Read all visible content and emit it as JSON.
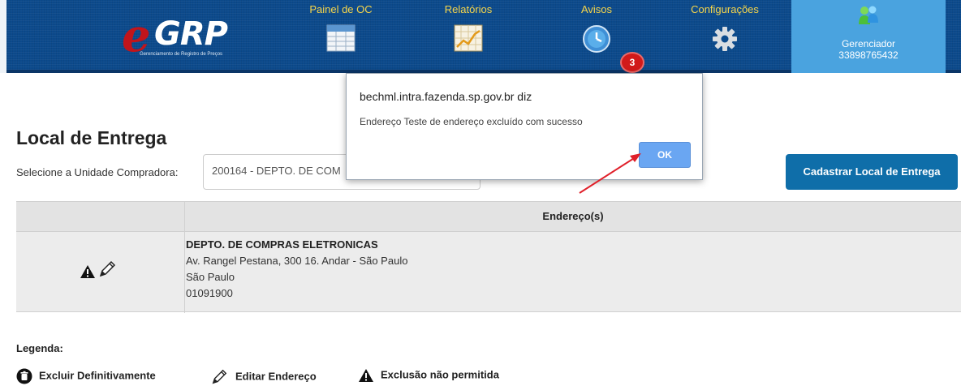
{
  "header": {
    "logo_text": "GRP",
    "logo_subtitle": "Gerenciamento de Registro de Preços",
    "nav": [
      {
        "label": "Painel de OC",
        "icon": "table-icon"
      },
      {
        "label": "Relatórios",
        "icon": "chart-icon"
      },
      {
        "label": "Avisos",
        "icon": "clock-icon"
      },
      {
        "label": "Configurações",
        "icon": "gear-icon"
      }
    ],
    "alerts_count": "3",
    "user": {
      "role": "Gerenciador",
      "id": "33898765432",
      "icon": "users-icon"
    }
  },
  "page": {
    "title": "Local de Entrega",
    "unit_label": "Selecione a Unidade Compradora:",
    "unit_value": "200164 - DEPTO. DE COM",
    "register_button": "Cadastrar Local de Entrega"
  },
  "table": {
    "header_address": "Endereço(s)",
    "rows": [
      {
        "name": "DEPTO. DE COMPRAS ELETRONICAS",
        "street": "Av. Rangel Pestana, 300 16. Andar - São Paulo",
        "city": "São Paulo",
        "zip": "01091900"
      }
    ]
  },
  "legend": {
    "title": "Legenda:",
    "items": [
      {
        "label": "Excluir Definitivamente",
        "icon": "trash-icon"
      },
      {
        "label": "Editar Endereço",
        "icon": "pencil-icon"
      },
      {
        "label": "Exclusão não permitida",
        "icon": "warning-icon"
      }
    ]
  },
  "dialog": {
    "title": "bechml.intra.fazenda.sp.gov.br diz",
    "message": "Endereço Teste de endereço excluído com sucesso",
    "ok_label": "OK"
  },
  "colors": {
    "header_bg": "#0c4a8c",
    "nav_label": "#f6d54a",
    "user_box": "#4aa3df",
    "primary_button": "#0f6ea9",
    "dialog_ok": "#6aa6f2",
    "annotation_arrow": "#e0202a"
  }
}
